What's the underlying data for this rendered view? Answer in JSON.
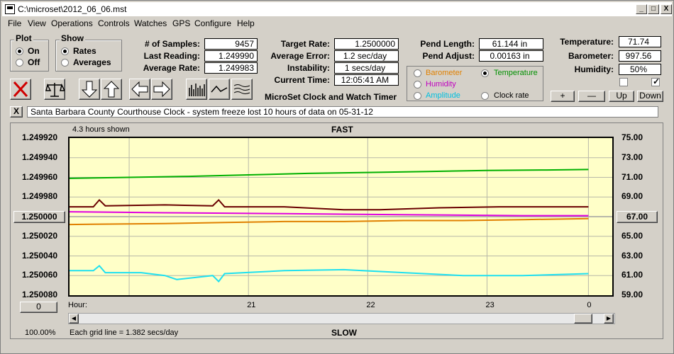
{
  "window": {
    "title": "C:\\microset\\2012_06_06.mst",
    "min": "_",
    "max": "□",
    "close": "X"
  },
  "menu": [
    "File",
    "View",
    "Operations",
    "Controls",
    "Watches",
    "GPS",
    "Configure",
    "Help"
  ],
  "plot_group": {
    "label": "Plot",
    "on": "On",
    "off": "Off",
    "selected": "On"
  },
  "show_group": {
    "label": "Show",
    "rates": "Rates",
    "averages": "Averages",
    "selected": "Rates"
  },
  "stats": {
    "samples_label": "# of Samples:",
    "samples": "9457",
    "last_label": "Last Reading:",
    "last": "1.249990",
    "avg_label": "Average Rate:",
    "avg": "1.249983",
    "target_label": "Target Rate:",
    "target": "1.2500000",
    "avgerr_label": "Average Error:",
    "avgerr": "1.2 sec/day",
    "instab_label": "Instability:",
    "instab": "1 secs/day",
    "time_label": "Current Time:",
    "time": "12:05:41 AM",
    "pendlen_label": "Pend Length:",
    "pendlen": "61.144 in",
    "pendadj_label": "Pend Adjust:",
    "pendadj": "0.00163 in",
    "temp_label": "Temperature:",
    "temp": "71.74",
    "baro_label": "Barometer:",
    "baro": "997.56",
    "hum_label": "Humidity:",
    "hum": "50%"
  },
  "app_name": "MicroSet Clock and Watch Timer",
  "series_select": {
    "barometer": "Barometer",
    "temperature": "Temperature",
    "humidity": "Humidity",
    "amplitude": "Amplitude",
    "clockrate": "Clock rate",
    "selected": "Temperature",
    "colors": {
      "barometer": "#e08000",
      "temperature": "#00a000",
      "humidity": "#c000c0",
      "amplitude": "#00c8e8",
      "clockrate": "#000000"
    }
  },
  "scale_buttons": {
    "plus": "+",
    "minus": "—",
    "up": "Up",
    "down": "Down"
  },
  "message": "Santa Barbara County Courthouse Clock - system freeze lost 10 hours of data on 05-31-12",
  "message_close": "X",
  "chart_header": {
    "hours_shown": "4.3 hours shown",
    "top": "FAST",
    "bottom": "SLOW",
    "zoom": "100.00%",
    "grid_note": "Each grid line = 1.382 secs/day",
    "left_center": "1.250000",
    "right_center": "67.00",
    "offset_btn": "0"
  },
  "chart_data": {
    "type": "line",
    "xlabel": "Hour:",
    "x_ticks": [
      "21",
      "22",
      "23",
      "0"
    ],
    "y_left_ticks": [
      "1.249920",
      "1.249940",
      "1.249960",
      "1.249980",
      "1.250000",
      "1.250020",
      "1.250040",
      "1.250060",
      "1.250080"
    ],
    "y_right_ticks": [
      "75.00",
      "73.00",
      "71.00",
      "69.00",
      "67.00",
      "65.00",
      "63.00",
      "61.00",
      "59.00"
    ],
    "y_left_range": [
      1.24992,
      1.25008
    ],
    "y_right_range": [
      59,
      75
    ],
    "x_range": [
      19.7,
      0.5
    ],
    "series": [
      {
        "name": "Temperature",
        "color": "#00b000",
        "x": [
          19.7,
          20.2,
          20.7,
          21.2,
          21.7,
          22.2,
          22.7,
          23.2,
          23.7,
          24.05
        ],
        "y": [
          70.9,
          71.0,
          71.1,
          71.25,
          71.4,
          71.5,
          71.6,
          71.7,
          71.75,
          71.8
        ]
      },
      {
        "name": "Clock rate",
        "color": "#6a0000",
        "x": [
          19.7,
          19.9,
          19.95,
          20.0,
          20.5,
          20.9,
          20.95,
          21.0,
          21.5,
          22.0,
          22.3,
          22.8,
          23.3,
          23.8,
          24.05
        ],
        "y": [
          1.24999,
          1.24999,
          1.249983,
          1.249989,
          1.249988,
          1.249989,
          1.249983,
          1.24999,
          1.24999,
          1.249993,
          1.249993,
          1.249991,
          1.24999,
          1.24999,
          1.24999
        ]
      },
      {
        "name": "Humidity",
        "color": "#e000e0",
        "x": [
          19.7,
          20.5,
          21.5,
          22.5,
          23.5,
          24.05
        ],
        "y": [
          1.249995,
          1.249996,
          1.249997,
          1.249998,
          1.249999,
          1.249999
        ]
      },
      {
        "name": "Barometer",
        "color": "#e08000",
        "x": [
          19.7,
          20.5,
          21.0,
          21.5,
          22.0,
          22.5,
          23.0,
          23.5,
          24.05
        ],
        "y": [
          1.250008,
          1.250007,
          1.250006,
          1.250005,
          1.250005,
          1.250004,
          1.250004,
          1.250003,
          1.250002
        ]
      },
      {
        "name": "Amplitude",
        "color": "#20e0f0",
        "x": [
          19.7,
          19.9,
          19.95,
          20.0,
          20.3,
          20.5,
          20.6,
          20.9,
          20.95,
          21.0,
          21.5,
          22.0,
          22.5,
          23.0,
          23.5,
          24.05
        ],
        "y": [
          1.250055,
          1.250055,
          1.25005,
          1.250057,
          1.250057,
          1.25006,
          1.250064,
          1.25006,
          1.250066,
          1.250058,
          1.250055,
          1.250054,
          1.250057,
          1.25006,
          1.25006,
          1.250058
        ]
      }
    ]
  },
  "checkboxes": [
    {
      "label": "",
      "checked": false
    },
    {
      "label": "",
      "checked": true
    }
  ]
}
